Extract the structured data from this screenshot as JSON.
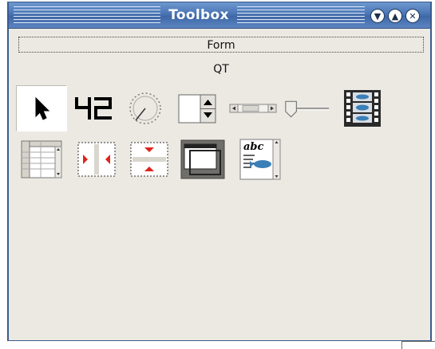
{
  "window": {
    "title": "Toolbox"
  },
  "title_buttons": [
    {
      "name": "minimize-button",
      "glyph": "▼"
    },
    {
      "name": "maximize-button",
      "glyph": "▲"
    },
    {
      "name": "close-button",
      "glyph": "✕"
    }
  ],
  "panels": {
    "form_label": "Form",
    "qt_label": "QT"
  },
  "widgets": [
    {
      "name": "pointer-tool",
      "icon": "arrow-pointer-icon",
      "selected": true
    },
    {
      "name": "lcd-number-tool",
      "icon": "lcd-number-icon",
      "text": "42"
    },
    {
      "name": "dial-tool",
      "icon": "dial-icon"
    },
    {
      "name": "spinbox-tool",
      "icon": "spinbox-icon"
    },
    {
      "name": "scrollbar-tool",
      "icon": "scrollbar-icon"
    },
    {
      "name": "slider-tool",
      "icon": "slider-icon"
    },
    {
      "name": "movie-tool",
      "icon": "film-strip-icon"
    },
    {
      "name": "table-tool",
      "icon": "table-icon"
    },
    {
      "name": "horizontal-spacer-tool",
      "icon": "horizontal-spacer-icon"
    },
    {
      "name": "vertical-spacer-tool",
      "icon": "vertical-spacer-icon"
    },
    {
      "name": "mdi-area-tool",
      "icon": "mdi-window-icon"
    },
    {
      "name": "text-edit-tool",
      "icon": "rich-text-icon",
      "text": "abc"
    }
  ],
  "colors": {
    "titlebar": "#4a75b5",
    "window_bg": "#ebe9e2",
    "spacer_red": "#e0241c",
    "icon_blue": "#3a7fb8"
  }
}
